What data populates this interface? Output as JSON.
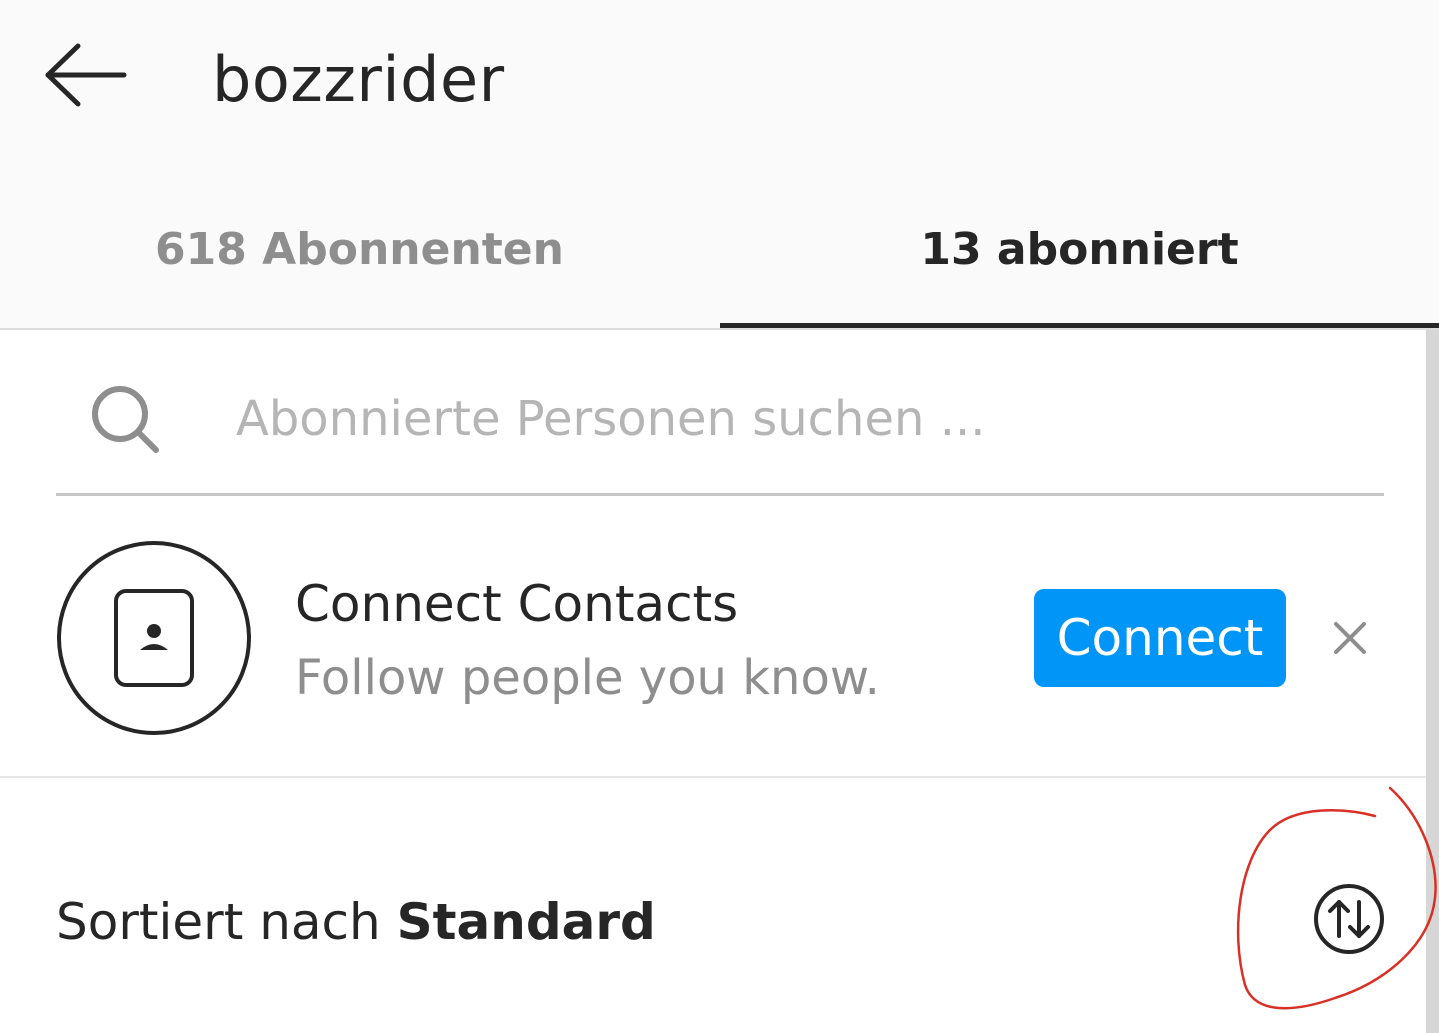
{
  "header": {
    "username": "bozzrider",
    "back_icon": "arrow-left-icon"
  },
  "tabs": [
    {
      "label": "618 Abonnenten",
      "active": false
    },
    {
      "label": "13 abonniert",
      "active": true
    }
  ],
  "search": {
    "placeholder": "Abonnierte Personen suchen ...",
    "value": "",
    "icon": "search-icon"
  },
  "contacts_card": {
    "title": "Connect Contacts",
    "subtitle": "Follow people you know.",
    "button_label": "Connect",
    "dismiss_label": "×",
    "icon": "contact-book-icon"
  },
  "sort": {
    "prefix": "Sortiert nach ",
    "value": "Standard",
    "icon": "sort-arrows-icon"
  },
  "colors": {
    "accent": "#0095f6",
    "text": "#262626",
    "muted": "#8e8e8e",
    "annotation": "#d93025"
  }
}
